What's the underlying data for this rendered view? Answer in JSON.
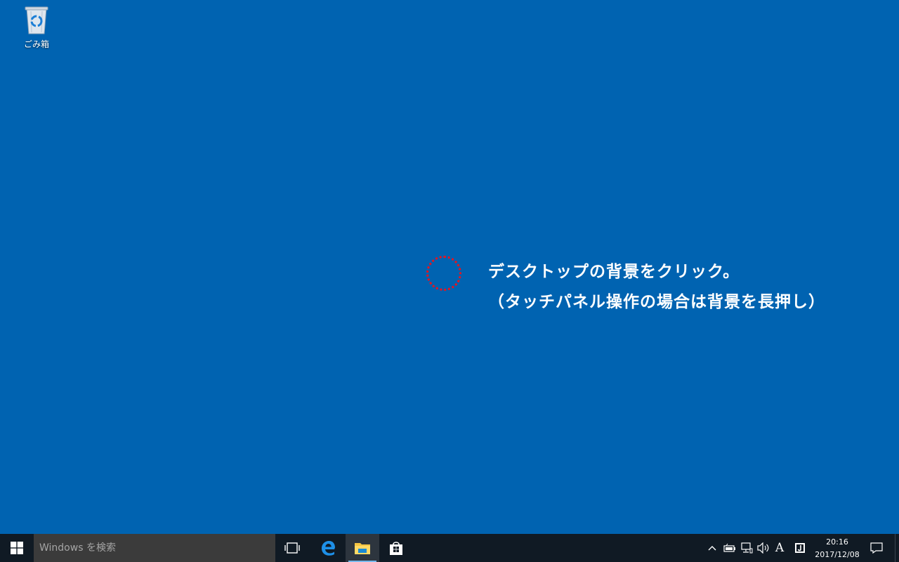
{
  "desktop": {
    "background_color": "#0063b1",
    "icons": [
      {
        "label": "ごみ箱",
        "icon": "recycle-bin-icon"
      }
    ]
  },
  "annotation": {
    "marker_color": "#e8141e",
    "line1": "デスクトップの背景をクリック。",
    "line2": "（タッチパネル操作の場合は背景を長押し）"
  },
  "taskbar": {
    "background_color": "#101a24",
    "start_icon": "windows-logo-icon",
    "search_placeholder": "Windows を検索",
    "pinned": [
      {
        "name": "task-view",
        "icon": "task-view-icon"
      },
      {
        "name": "edge",
        "icon": "edge-icon"
      },
      {
        "name": "file-explorer",
        "icon": "file-explorer-icon",
        "active": true
      },
      {
        "name": "store",
        "icon": "store-icon"
      }
    ],
    "tray": {
      "icons": [
        "chevron-up-icon",
        "battery-icon",
        "network-icon",
        "volume-icon",
        "ime-icon",
        "notification-app-icon"
      ],
      "ime_label": "A",
      "time": "20:16",
      "date": "2017/12/08"
    }
  }
}
